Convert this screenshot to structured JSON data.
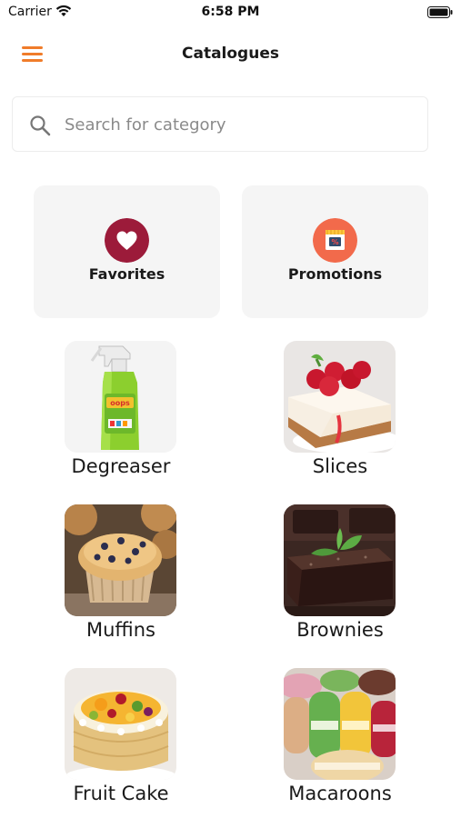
{
  "status_bar": {
    "carrier": "Carrier",
    "time": "6:58 PM"
  },
  "header": {
    "title": "Catalogues",
    "menu_icon": "hamburger-menu-icon"
  },
  "search": {
    "placeholder": "Search for category",
    "value": ""
  },
  "quick_links": [
    {
      "label": "Favorites",
      "icon": "heart-icon",
      "color": "#9c1b3a"
    },
    {
      "label": "Promotions",
      "icon": "promotion-icon",
      "color": "#f26a4b"
    }
  ],
  "categories": [
    {
      "label": "Degreaser"
    },
    {
      "label": "Slices"
    },
    {
      "label": "Muffins"
    },
    {
      "label": "Brownies"
    },
    {
      "label": "Fruit Cake"
    },
    {
      "label": "Macaroons"
    }
  ],
  "colors": {
    "accent": "#f07c2a",
    "card_bg": "#f5f5f5"
  }
}
